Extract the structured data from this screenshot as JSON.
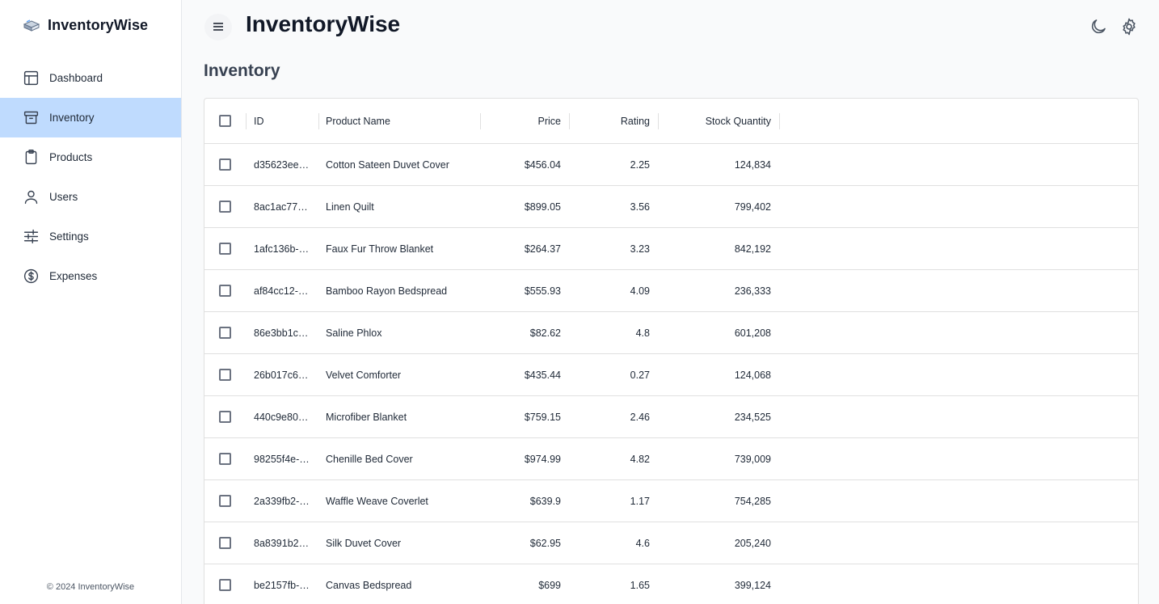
{
  "app": {
    "brand": "InventoryWise",
    "title": "InventoryWise",
    "footer": "© 2024 InventoryWise"
  },
  "sidebar": {
    "items": [
      {
        "label": "Dashboard",
        "icon": "layout-icon",
        "active": false
      },
      {
        "label": "Inventory",
        "icon": "archive-icon",
        "active": true
      },
      {
        "label": "Products",
        "icon": "clipboard-icon",
        "active": false
      },
      {
        "label": "Users",
        "icon": "user-icon",
        "active": false
      },
      {
        "label": "Settings",
        "icon": "sliders-icon",
        "active": false
      },
      {
        "label": "Expenses",
        "icon": "dollar-circle-icon",
        "active": false
      }
    ]
  },
  "page": {
    "title": "Inventory"
  },
  "table": {
    "columns": {
      "id": "ID",
      "name": "Product Name",
      "price": "Price",
      "rating": "Rating",
      "stock": "Stock Quantity"
    },
    "rows": [
      {
        "id": "d35623ee…",
        "name": "Cotton Sateen Duvet Cover",
        "price": "$456.04",
        "rating": "2.25",
        "stock": "124,834"
      },
      {
        "id": "8ac1ac77…",
        "name": "Linen Quilt",
        "price": "$899.05",
        "rating": "3.56",
        "stock": "799,402"
      },
      {
        "id": "1afc136b-…",
        "name": "Faux Fur Throw Blanket",
        "price": "$264.37",
        "rating": "3.23",
        "stock": "842,192"
      },
      {
        "id": "af84cc12-…",
        "name": "Bamboo Rayon Bedspread",
        "price": "$555.93",
        "rating": "4.09",
        "stock": "236,333"
      },
      {
        "id": "86e3bb1c…",
        "name": "Saline Phlox",
        "price": "$82.62",
        "rating": "4.8",
        "stock": "601,208"
      },
      {
        "id": "26b017c6…",
        "name": "Velvet Comforter",
        "price": "$435.44",
        "rating": "0.27",
        "stock": "124,068"
      },
      {
        "id": "440c9e80…",
        "name": "Microfiber Blanket",
        "price": "$759.15",
        "rating": "2.46",
        "stock": "234,525"
      },
      {
        "id": "98255f4e-…",
        "name": "Chenille Bed Cover",
        "price": "$974.99",
        "rating": "4.82",
        "stock": "739,009"
      },
      {
        "id": "2a339fb2-…",
        "name": "Waffle Weave Coverlet",
        "price": "$639.9",
        "rating": "1.17",
        "stock": "754,285"
      },
      {
        "id": "8a8391b2…",
        "name": "Silk Duvet Cover",
        "price": "$62.95",
        "rating": "4.6",
        "stock": "205,240"
      },
      {
        "id": "be2157fb-…",
        "name": "Canvas Bedspread",
        "price": "$699",
        "rating": "1.65",
        "stock": "399,124"
      }
    ]
  },
  "colors": {
    "active_nav_bg": "#bfdbfe",
    "background": "#f9fafb",
    "sidebar_bg": "#ffffff"
  }
}
